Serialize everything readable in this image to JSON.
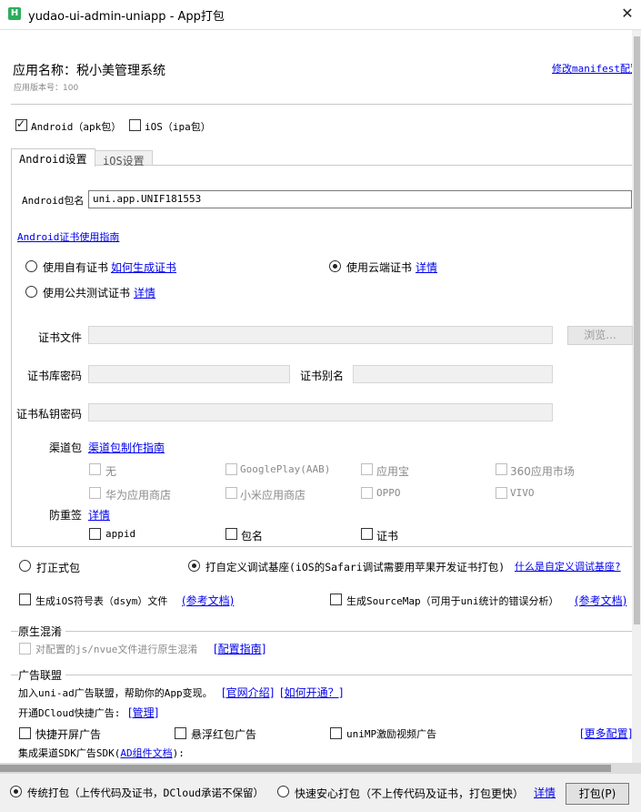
{
  "window": {
    "title": "yudao-ui-admin-uniapp - App打包",
    "icon_label": "H"
  },
  "header": {
    "app_name": "应用名称：税小美管理系统",
    "app_version": "应用版本号：100",
    "edit_manifest_link": "修改manifest配置"
  },
  "platforms": {
    "android_label": "Android（apk包）",
    "ios_label": "iOS（ipa包）",
    "android_checked": true,
    "ios_checked": false
  },
  "tabs": {
    "android": "Android设置",
    "ios": "iOS设置"
  },
  "android": {
    "package_label": "Android包名",
    "package_value": "uni.app.UNIF181553",
    "cert_guide_link": "Android证书使用指南",
    "cert_options": {
      "own_label": "使用自有证书",
      "own_link": "如何生成证书",
      "cloud_label": "使用云端证书",
      "cloud_link": "详情",
      "public_label": "使用公共测试证书",
      "public_link": "详情",
      "selected": "cloud"
    },
    "cert_file_label": "证书文件",
    "browse_button": "浏览...",
    "keystore_password_label": "证书库密码",
    "alias_label": "证书别名",
    "private_key_password_label": "证书私钥密码",
    "channel_label": "渠道包",
    "channel_guide_link": "渠道包制作指南",
    "channels": [
      "无",
      "GooglePlay(AAB)",
      "应用宝",
      "360应用市场",
      "华为应用商店",
      "小米应用商店",
      "OPPO",
      "VIVO"
    ],
    "anti_tamper_label": "防重签",
    "anti_tamper_link": "详情",
    "anti_tamper_options": [
      "appid",
      "包名",
      "证书"
    ]
  },
  "build_type": {
    "release_label": "打正式包",
    "custom_base_label": "打自定义调试基座(iOS的Safari调试需要用苹果开发证书打包)",
    "custom_base_link": "什么是自定义调试基座?",
    "selected": "custom_base"
  },
  "symbols": {
    "ios_dsym_label": "生成iOS符号表（dsym）文件",
    "ios_dsym_link": "(参考文档)",
    "sourcemap_label": "生成SourceMap（可用于uni统计的错误分析）",
    "sourcemap_link": "(参考文档)"
  },
  "obfuscation": {
    "title": "原生混淆",
    "option_label": "对配置的js/nvue文件进行原生混淆",
    "guide_link": "[配置指南]"
  },
  "ads": {
    "title": "广告联盟",
    "intro_text": "加入uni-ad广告联盟，帮助你的App变现。",
    "intro_link": "[官网介绍]",
    "how_link": "[如何开通？]",
    "dcloud_label": "开通DCloud快捷广告:",
    "manage_link": "[管理]",
    "splash_label": "快捷开屏广告",
    "float_label": "悬浮红包广告",
    "reward_label": "uniMP激励视频广告",
    "more_link": "[更多配置]",
    "sdk_label_prefix": "集成渠道SDK广告SDK(",
    "sdk_link": "AD组件文档",
    "sdk_label_suffix": "):"
  },
  "footer": {
    "traditional_label": "传统打包（上传代码及证书，DCloud承诺不保留）",
    "safe_label": "快速安心打包（不上传代码及证书，打包更快）",
    "details_link": "详情",
    "pack_button": "打包(P)",
    "selected": "traditional"
  }
}
